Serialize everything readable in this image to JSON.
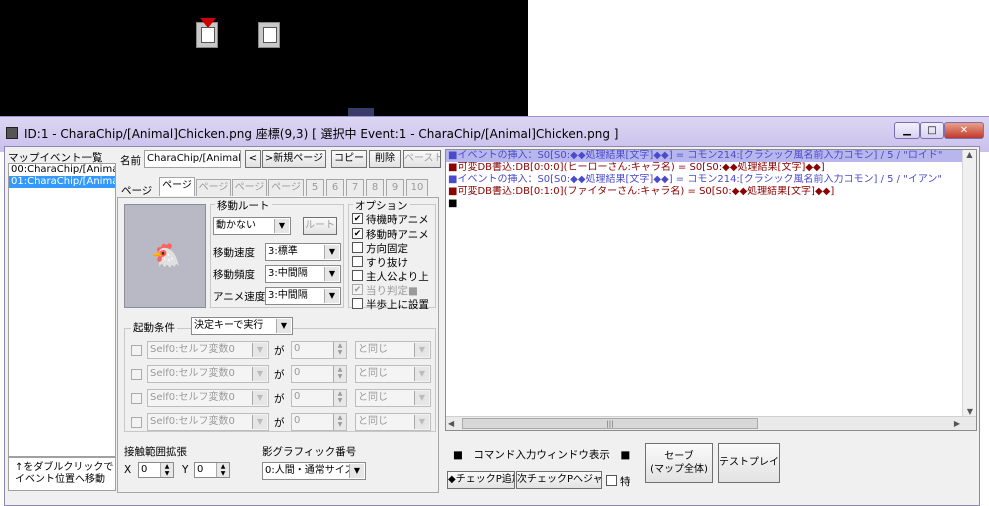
{
  "colors": {
    "title_bar": "#c9c0ec",
    "command_blue": "#4a4acc",
    "command_red": "#8b0000",
    "selection": "#3399ff"
  },
  "window": {
    "title": "ID:1 - CharaChip/[Animal]Chicken.png 座標(9,3) [ 選択中 Event:1 - CharaChip/[Animal]Chicken.png ]",
    "min_label": "▁",
    "max_label": "□",
    "close_label": "✕"
  },
  "event_list": {
    "header": "マップイベント一覧",
    "items": [
      "00:CharaChip/[Animal",
      "01:CharaChip/[Animal"
    ],
    "hint": "↑をダブルクリックで\nイベント位置へ移動"
  },
  "toolbar": {
    "name_label": "名前",
    "name_value": "CharaChip/[Animal]C",
    "prev": "<",
    "next_page": ">新規ページ",
    "copy": "コピー",
    "delete": "削除",
    "paste": "ペースト"
  },
  "pages": {
    "label": "ページ",
    "tabs": [
      "ページ1",
      "ページ2",
      "ページ3",
      "ページ4",
      "5",
      "6",
      "7",
      "8",
      "9",
      "10"
    ]
  },
  "movement": {
    "title": "移動ルート",
    "route_value": "動かない",
    "route_button": "ルート",
    "speed_label": "移動速度",
    "speed_value": "3:標準",
    "freq_label": "移動頻度",
    "freq_value": "3:中間隔",
    "anim_label": "アニメ速度",
    "anim_value": "3:中間隔"
  },
  "options": {
    "title": "オプション",
    "items": [
      {
        "label": "待機時アニメ",
        "checked": "✔"
      },
      {
        "label": "移動時アニメ",
        "checked": "✔"
      },
      {
        "label": "方向固定",
        "checked": ""
      },
      {
        "label": "すり抜け",
        "checked": ""
      },
      {
        "label": "主人公より上",
        "checked": ""
      },
      {
        "label": "当り判定■",
        "checked": "✔"
      },
      {
        "label": "半歩上に設置",
        "checked": ""
      }
    ]
  },
  "trigger": {
    "title": "起動条件",
    "value": "決定キーで実行",
    "rows": [
      {
        "var": "Self0:セルフ変数0",
        "ga": "が",
        "num": "0",
        "cmp": "と同じ"
      },
      {
        "var": "Self0:セルフ変数0",
        "ga": "が",
        "num": "0",
        "cmp": "と同じ"
      },
      {
        "var": "Self0:セルフ変数0",
        "ga": "が",
        "num": "0",
        "cmp": "と同じ"
      },
      {
        "var": "Self0:セルフ変数0",
        "ga": "が",
        "num": "0",
        "cmp": "と同じ"
      }
    ]
  },
  "contact": {
    "title": "接触範囲拡張",
    "x_label": "X",
    "x_value": "0",
    "y_label": "Y",
    "y_value": "0"
  },
  "shadow": {
    "title": "影グラフィック番号",
    "value": "0:人間・通常サイズ"
  },
  "commands": [
    "■イベントの挿入：S0[S0:◆◆処理結果[文字]◆◆] = コモン214:[クラシック風名前入力コモン] / 5 / \"ロイド\"",
    "■可変DB書込:DB[0:0:0](ヒーローさん:キャラ名) = S0[S0:◆◆処理結果[文字]◆◆]",
    "■イベントの挿入：S0[S0:◆◆処理結果[文字]◆◆] = コモン214:[クラシック風名前入力コモン] / 5 / \"イアン\"",
    "■可変DB書込:DB[0:1:0](ファイターさん:キャラ名) = S0[S0:◆◆処理結果[文字]◆◆]",
    "■"
  ],
  "bottom": {
    "cmd_window": "■　コマンド入力ウィンドウ表示　■",
    "add_check": "◆チェックP追加",
    "jump_check": "次チェックPへジャンプ",
    "toku": "特",
    "save": "セーブ\n(マップ全体)",
    "testplay": "テストプレイ",
    "scroll_mark": "|||"
  }
}
